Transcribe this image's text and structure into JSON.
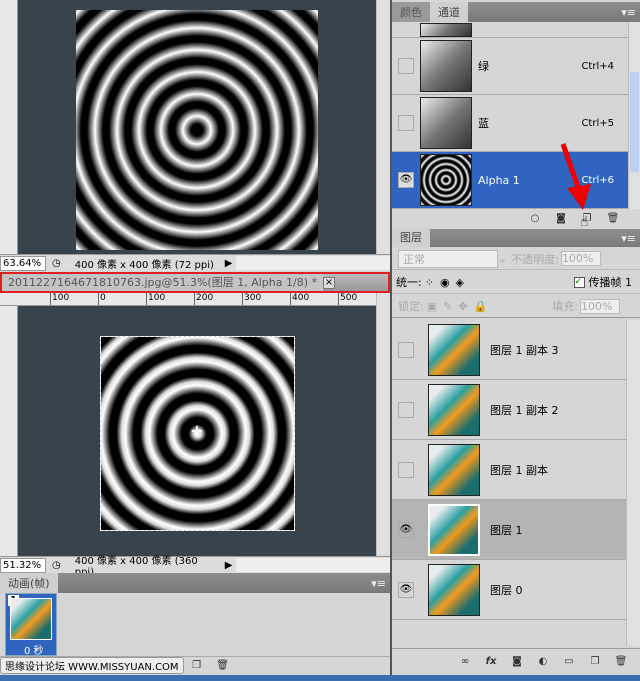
{
  "doc1": {
    "zoom": "63.64%",
    "size_info": "400 像素 x 400 像素 (72 ppi)"
  },
  "doc2": {
    "title": "20112271646718107​63.jpg@51.3%(图层 1, Alpha 1/8) *",
    "zoom": "51.32%",
    "size_info": "400 像素 x 400 像素 (360 ppi)",
    "ruler_ticks": [
      "100",
      "0",
      "100",
      "200",
      "300",
      "400",
      "500"
    ]
  },
  "channels_panel": {
    "tabs": [
      "颜色",
      "通道"
    ],
    "active_tab": "通道",
    "rows": [
      {
        "name": "绿",
        "shortcut": "Ctrl+4",
        "visible": false
      },
      {
        "name": "蓝",
        "shortcut": "Ctrl+5",
        "visible": false
      },
      {
        "name": "Alpha 1",
        "shortcut": "Ctrl+6",
        "visible": true,
        "selected": true
      }
    ]
  },
  "layers_panel": {
    "tab": "图层",
    "blend_mode": "正常",
    "opacity_label": "不透明度:",
    "opacity": "100%",
    "unify_label": "统一:",
    "propagate_label": "传播帧 1",
    "propagate_checked": true,
    "lock_label": "锁定:",
    "fill_label": "填充:",
    "fill": "100%",
    "layers": [
      {
        "name": "图层 1 副本 3",
        "visible": false
      },
      {
        "name": "图层 1 副本 2",
        "visible": false
      },
      {
        "name": "图层 1 副本",
        "visible": false
      },
      {
        "name": "图层 1",
        "visible": true,
        "selected": true
      },
      {
        "name": "图层 0",
        "visible": true
      }
    ]
  },
  "animation_panel": {
    "tab": "动画(帧)",
    "frame_number": "1",
    "frame_delay": "0 秒"
  },
  "watermark": "思缘设计论坛 WWW.MISSYUAN.COM",
  "colors": {
    "selection": "#2f64c0",
    "canvas": "#37444c",
    "highlight_border": "#e02020"
  }
}
